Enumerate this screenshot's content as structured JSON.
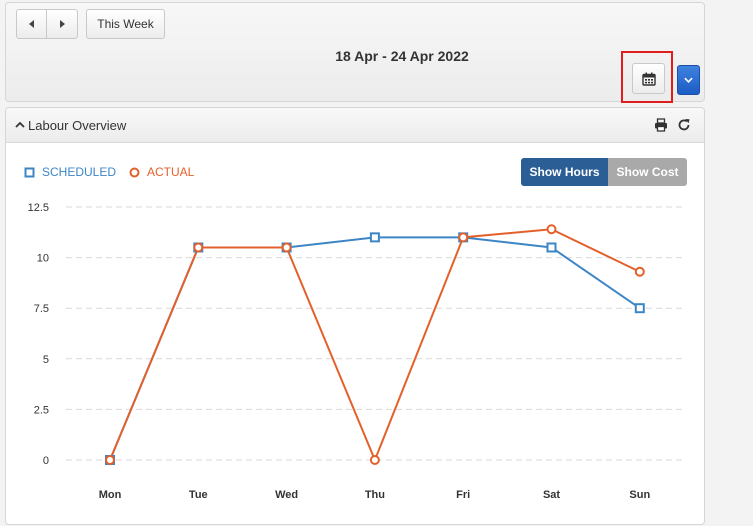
{
  "toolbar": {
    "prev_icon": "caret-left-icon",
    "next_icon": "caret-right-icon",
    "this_week_label": "This Week",
    "date_range": "18 Apr - 24 Apr 2022",
    "calendar_icon": "calendar-icon",
    "dropdown_icon": "chevron-down-icon",
    "dropdown_color": "#2563c9"
  },
  "labour": {
    "title": "Labour Overview",
    "collapse_icon": "chevron-up-icon",
    "print_icon": "printer-icon",
    "refresh_icon": "refresh-icon",
    "toggle": {
      "hours_label": "Show Hours",
      "cost_label": "Show Cost",
      "active": "hours"
    }
  },
  "chart_data": {
    "type": "line",
    "categories": [
      "Mon",
      "Tue",
      "Wed",
      "Thu",
      "Fri",
      "Sat",
      "Sun"
    ],
    "series": [
      {
        "name": "SCHEDULED",
        "color": "#3d86c6",
        "marker": "square",
        "values": [
          0,
          10.5,
          10.5,
          11,
          11,
          10.5,
          7.5
        ]
      },
      {
        "name": "ACTUAL",
        "color": "#e4602b",
        "marker": "circle",
        "values": [
          0,
          10.5,
          10.5,
          0,
          11,
          11.4,
          9.3
        ]
      }
    ],
    "yticks": [
      "0",
      "2.5",
      "5",
      "7.5",
      "10",
      "12.5"
    ],
    "ylim": [
      0,
      12.5
    ],
    "grid": true,
    "legend": "top-left"
  }
}
